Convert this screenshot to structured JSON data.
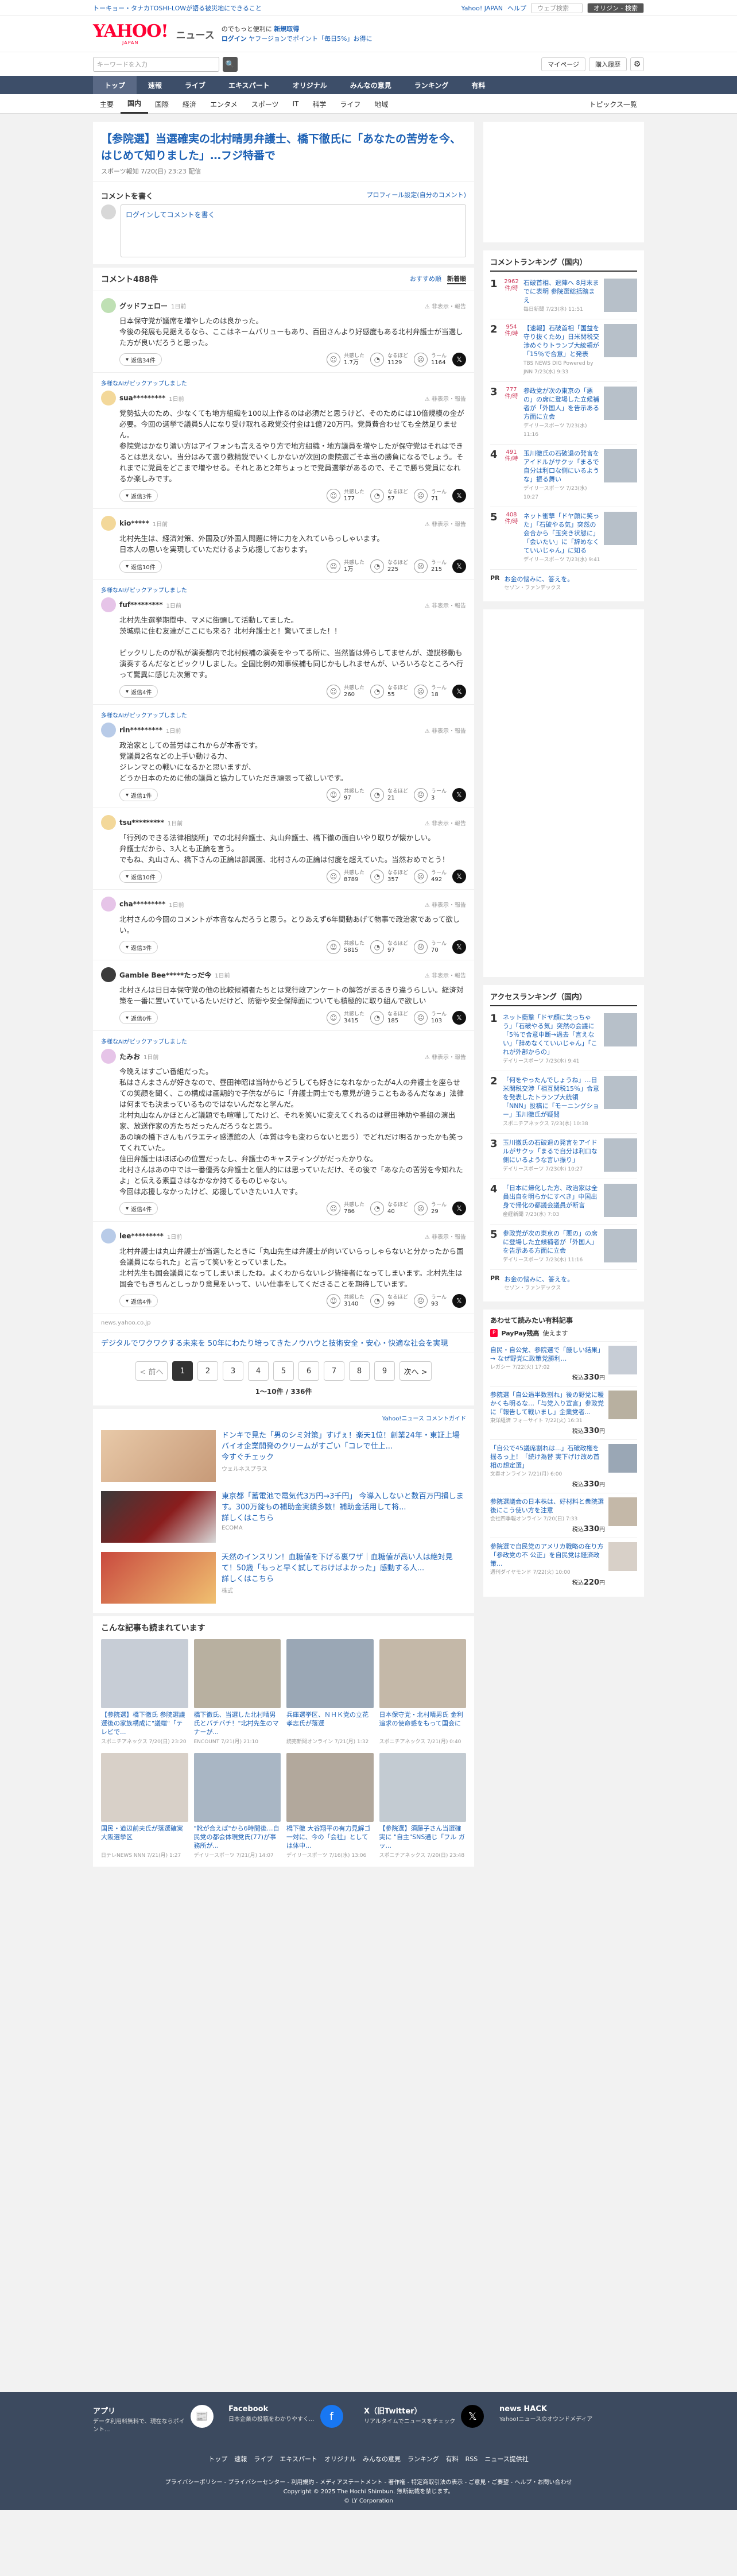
{
  "topstrip": {
    "promo": "トーキョー・タナカTOSHI-LOWが語る被災地にできること",
    "right": [
      "Yahoo! JAPAN",
      "ヘルプ"
    ],
    "search_placeholder": "ウェブ検索",
    "search_btn": "オリジン - 検索"
  },
  "header": {
    "logo": "YAHOO!",
    "logo_sub": "JAPAN",
    "news": "ニュース",
    "line1": "のでもっと便利に",
    "line1_link": "新規取得",
    "line2_login": "ログイン",
    "line2_link": "ヤフージョンでポイント「毎日5%」お得に"
  },
  "search": {
    "placeholder": "キーワードを入力",
    "btn": "🔍",
    "mypage": "マイページ",
    "settings": "購入履歴"
  },
  "nav1": [
    "トップ",
    "速報",
    "ライブ",
    "エキスパート",
    "オリジナル",
    "みんなの意見",
    "ランキング",
    "有料"
  ],
  "nav2": [
    "主要",
    "国内",
    "国際",
    "経済",
    "エンタメ",
    "スポーツ",
    "IT",
    "科学",
    "ライフ",
    "地域"
  ],
  "nav2_right": "トピックス一覧",
  "article": {
    "title": "【参院選】当選確実の北村晴男弁護士、橋下徹氏に「あなたの苦労を今、はじめて知りました」…フジ特番で",
    "source": "スポーツ報知 7/20(日) 23:23 配信"
  },
  "comment_write": {
    "title": "コメントを書く",
    "profile_link": "プロフィール設定(自分のコメント)",
    "placeholder": "ログインしてコメントを書く"
  },
  "comment_head": {
    "title": "コメント488件",
    "sort1": "おすすめ順",
    "sort2": "新着順"
  },
  "comments": [
    {
      "pick": "",
      "name": "グッドフェロー",
      "time": "1日前",
      "body": "日本保守党が議席を増やしたのは良かった。\n今後の発展も見据えるなら、ここはネームバリューもあり、百田さんより好感度もある北村弁護士が当選した方が良いだろうと思った。",
      "replies": "返信34件",
      "v1": "1.7万",
      "v2": "1129",
      "v3": "1164"
    },
    {
      "pick": "多様なAIがピックアップしました",
      "name": "sua*********",
      "time": "1日前",
      "body": "党勢拡大のため、少なくても地方組織を100以上作るのは必須だと思うけど、そのためには10倍規模の金が必要。今回の選挙で議員5人になり受け取れる政党交付金は1億720万円。党員費合わせても全然足りません。\n参院党はかなり潰い方はアイフォンも言えるやり方で地方組織・地方議員を増やしたが保守党はそれはできるとは思えない。当分はみて選り数精鋭でいくしかないが次回の衆院選ごそ本当の勝負になるでしょう。それまでに党員をどこまで増やせる。それとあと2年ちょっとで党員選挙があるので、そこで勝ち党員になれるか楽しみです。",
      "replies": "返信3件",
      "v1": "177",
      "v2": "57",
      "v3": "71"
    },
    {
      "pick": "",
      "name": "kio*****",
      "time": "1日前",
      "body": "北村先生は、経済対策、外国及び外国人問題に特に力を入れていらっしゃいます。\n日本人の思いを実現していただけるよう応援しております。",
      "replies": "返信10件",
      "v1": "1万",
      "v2": "225",
      "v3": "215"
    },
    {
      "pick": "多様なAIがピックアップしました",
      "name": "fuf*********",
      "time": "1日前",
      "body": "北村先生選挙期間中、マメに街頭して活動してました。\n茨城県に住む友達がここにも来る？北村弁護士と！驚いてました！！\n\nピックリしたのが私が演奏都内で北村候補の演奏をやってる所に、当然皆は帰らしてませんが、遊説移動も演奏するんだなとビックリしました。全国比例の知事候補も同じかもしれませんが、いろいろなところへ行って驚異に感じた次第です。",
      "replies": "返信4件",
      "v1": "260",
      "v2": "55",
      "v3": "18"
    },
    {
      "pick": "多様なAIがピックアップしました",
      "name": "rin*********",
      "time": "1日前",
      "body": "政治家としての苦労はこれからが本番です。\n党議員2名などの上手い動ける力、\nジレンマとの戦いになるかと思いますが、\nどうか日本のために他の議員と協力していただき頑張って欲しいです。",
      "replies": "返信1件",
      "v1": "97",
      "v2": "21",
      "v3": "3"
    },
    {
      "pick": "",
      "name": "tsu*********",
      "time": "1日前",
      "body": "「行列のできる法律相談所」での北村弁護士、丸山弁護士、橋下徹の面白いやり取りが懐かしい。\n弁護士だから、3人とも正論を言う。\nでもね、丸山さん、橋下さんの正論は部属面、北村さんの正論は付度を超えていた。当然おめでとう！",
      "replies": "返信10件",
      "v1": "8789",
      "v2": "357",
      "v3": "492"
    },
    {
      "pick": "",
      "name": "cha*********",
      "time": "1日前",
      "body": "北村さんの今回のコメントが本音なんだろうと思う。とりあえず6年間動あげて物事で政治家であって欲しい。",
      "replies": "返信3件",
      "v1": "5815",
      "v2": "97",
      "v3": "70"
    },
    {
      "pick": "",
      "name": "Gamble Bee*****たっだ今",
      "time": "1日前",
      "body": "北村さんは日日本保守党の他の比較候補者たちとは党行政アンケートの解答がまるきり違うらしい。経済対策を一番に置いていているたいだけど、防衛や安全保障面についても積極的に取り組んで欲しい",
      "replies": "返信0件",
      "v1": "3415",
      "v2": "185",
      "v3": "103"
    },
    {
      "pick": "多様なAIがピックアップしました",
      "name": "たみお",
      "time": "1日前",
      "body": "今晩えほすごい番組だった。\n私はさんまさんが好きなので、昼田神昭は当時からどうしても好きになれなかったが4人の弁護士を座らせての笑顔を聞く、この構成は画期的で子供ながらに「弁護士同士でも意見が違うこともあるんだなぁ」法律は何までも決まっているものではないんだなと学んだ。\n北村丸山なんかほとんど議題でも喧嘩してたけど、それを笑いに変えてくれるのは昼田神助や番組の演出家、放送作家の方たちだったんだろうなと思う。\nあの頃の橋下さんもバラエティ感漂館の人（本質は今も変わらないと思う）でどれだけ明るかったかも笑ってくれていた。\n住田弁護士はほぼ心の位置だったし、弁護士のキャスティングがだったかりな。\n北村さんはあの中では一番優秀な弁護士と個人的には思っていただけ、その後で「あなたの苦労を今知れたよ」と伝える素直さはなかなか持てるものじゃない。\n今回は応援しなかったけど、応援していきたい1人です。",
      "replies": "返信4件",
      "v1": "786",
      "v2": "40",
      "v3": "29"
    },
    {
      "pick": "",
      "name": "lee*********",
      "time": "1日前",
      "body": "北村弁護士は丸山弁護士が当選したときに「丸山先生は弁護士が向いていらっしゃらないと分かったから国会議員になられた」と言って笑いをとっていました。\n北村先生も国会議員になってしまいましたね。よくわからないレジ皆接者になってしまいます。北村先生は国会でもきちんとしっかり意見をいって、いい仕事をしてくださることを期待しています。",
      "replies": "返信4件",
      "v1": "3140",
      "v2": "99",
      "v3": "93"
    }
  ],
  "yahoo_note": "news.yahoo.co.jp",
  "promo_comment": {
    "text": "デジタルでワクワクする未来を 50年にわたり培ってきたノウハウと技術安全・安心・快適な社会を実現",
    "sponsor": ""
  },
  "pager": {
    "prev": "< 前へ",
    "pages": [
      "1",
      "2",
      "3",
      "4",
      "5",
      "6",
      "7",
      "8",
      "9"
    ],
    "next": "次へ >",
    "count": "1〜10件 / 336件"
  },
  "ads": {
    "head": "Yahoo!ニュース コメントガイド",
    "items": [
      {
        "text": "ドンキで見た「男のシミ対策」すげぇ！楽天1位！創業24年・東証上場バイオ企業開発のクリームがすごい「コレで仕上...",
        "more": "今すぐチェック",
        "sponsor": "ウェルネスプラス"
      },
      {
        "text": "東京都「蓄電池で電気代3万円→3千円」 今導入しないと数百万円損します。300万錠もの補助金実績多数！補助金活用して将...",
        "more": "詳しくはこちら",
        "sponsor": "ECOMA"
      },
      {
        "text": "天然のインスリン！血糖値を下げる裏ワザ｜血糖値が高い人は絶対見て！50歳「もっと早く試しておけばよかった」感動する人...",
        "more": "詳しくはこちら",
        "sponsor": "株式"
      }
    ]
  },
  "read_more": {
    "title": "こんな記事も読まれています",
    "items": [
      {
        "t": "【参院選】橋下徹氏 参院選議選後の家族構成に\"議端\"「テレビで...",
        "s": "スポニチアネックス 7/20(日) 23:20"
      },
      {
        "t": "橋下徹氏、当選した北村晴男氏とバチバチ！\"北村先生のマナーが...",
        "s": "ENCOUNT 7/21(月) 21:10"
      },
      {
        "t": "兵庫選挙区、ＮＨＫ党の立花孝志氏が落選",
        "s": "読売新聞オンライン 7/21(月) 1:32"
      },
      {
        "t": "日本保守党・北村晴男氏 金利追求の使命感をもって国会に",
        "s": "スポニチアネックス 7/21(月) 0:40"
      },
      {
        "t": "国民・道辺前夫氏が落選確実 大阪選挙区",
        "s": "日テレNEWS NNN 7/21(月) 1:27"
      },
      {
        "t": "\"靴が合えば\"から6時間後…自民党の都会体現党氏(77)が事務所が...",
        "s": "デイリースポーツ 7/21(月) 14:07"
      },
      {
        "t": "橋下徹 大谷翔平の有力見解ゴ一対に、今の「会社」としては体中...",
        "s": "デイリースポーツ 7/16(水) 13:06"
      },
      {
        "t": "【参院選】須藤子さん当選確実に \"自主\"SNS通じ「フル ガッ...",
        "s": "スポニチアネックス 7/20(日) 23:48"
      }
    ]
  },
  "ranking": {
    "title": "コメントランキング（国内）",
    "items": [
      {
        "n": "1",
        "c": "2962",
        "cl": "件/時",
        "t": "石破首相、退陣へ 8月末までに表明 参院選総括踏まえ",
        "s": "毎日新聞 7/23(水) 11:51"
      },
      {
        "n": "2",
        "c": "954",
        "cl": "件/時",
        "t": "【速報】石破首相「国益を守り抜くため」日米関税交渉めぐりトランプ大統領が「15％で合意」と発表",
        "s": "TBS NEWS DIG Powered by JNN 7/23(水) 9:33"
      },
      {
        "n": "3",
        "c": "777",
        "cl": "件/時",
        "t": "参政党が次の東京の「悪の」の席に登場した立候補者が「外国人」を告示ある方面に立会",
        "s": "デイリースポーツ 7/23(水) 11:16"
      },
      {
        "n": "4",
        "c": "491",
        "cl": "件/時",
        "t": "玉川徹氏の石破退の発言をアイドルがサクッ「まるで自分は利口な側にいるような」振る舞い",
        "s": "デイリースポーツ 7/23(水) 10:27"
      },
      {
        "n": "5",
        "c": "408",
        "cl": "件/時",
        "t": "ネット衝撃「ドヤ顔に笑った」「石破やる気」突然の会合から「玉突き状態に」「会いたい」に「辞めなくていいじゃん」に知る",
        "s": "デイリースポーツ 7/23(水) 9:41"
      }
    ],
    "pr": {
      "label": "PR",
      "t": "お金の悩みに、答えを。",
      "s": "セゾン・ファンデックス"
    }
  },
  "access": {
    "title": "アクセスランキング（国内）",
    "items": [
      {
        "n": "1",
        "t": "ネット衝撃「ドヤ顔に笑っちゃう」「石破やる気」突然の会議に「5％で合意中断→過去「言えない」「辞めなくていいじゃん」「これが外部からの」",
        "s": "デイリースポーツ 7/23(水) 9:41"
      },
      {
        "n": "2",
        "t": "「何をやったんでしょうね」…日米関税交渉「相互関税15％」合意を発表したトランプ大統領「NNN」投稿に「モーニングショー」玉川徹氏が疑問",
        "s": "スポニチアネックス 7/23(水) 10:38"
      },
      {
        "n": "3",
        "t": "玉川徹氏の石破退の発言をアイドルがサクッ「まるで自分は利口な側にいるような言い振り」",
        "s": "デイリースポーツ 7/23(水) 10:27"
      },
      {
        "n": "4",
        "t": "「日本に帰化した方、政治家は全員出自を明らかにすべき」中国出身で帰化の都議会議員が断言",
        "s": "産経新聞 7/23(水) 7:03"
      },
      {
        "n": "5",
        "t": "参政党が次の東京の「悪の」の席に登場した立候補者が「外国人」を告示ある方面に立会",
        "s": "デイリースポーツ 7/23(水) 11:16"
      }
    ],
    "pr": {
      "label": "PR",
      "t": "お金の悩みに、答えを。",
      "s": "セゾン・ファンデックス"
    }
  },
  "shop": {
    "title": "あわせて読みたい有料記事",
    "paypay": "PayPay残高",
    "paypay_tag": "使えます",
    "items": [
      {
        "t": "自民・自公党、参院選で「厳しい結果」→ なぜ野党に政策党勝利...",
        "s": "レガシー 7/22(火) 17:02",
        "p": "330"
      },
      {
        "t": "参院選「自公過半数割れ」後の野党に暖かくも明るな…「与党入り宣言」参政党に「報告して戦いまし」企業党者...",
        "s": "東洋経済 フォーサイト 7/22(火) 16:31",
        "p": "330"
      },
      {
        "t": "「自公で45議席割れは...」石破政権を揺るっ上！「続け為替 実下げけ改め首相の想定選」",
        "s": "文春オンライン 7/21(月) 6:00",
        "p": "330"
      },
      {
        "t": "参院選議会の日本株は、好材料と衆院選後にこう使い方を注意",
        "s": "会社四季報オンライン 7/20(日) 7:33",
        "p": "330"
      },
      {
        "t": "参院選で自民党のアメリカ戦略の在り方「参政党の不 公正」を自民党は経済政策...",
        "s": "週刊ダイヤモンド 7/22(火) 10:00",
        "p": "220"
      }
    ]
  },
  "footer": {
    "cols": [
      {
        "t": "アプリ",
        "d": "データ利用料無料で、現在ならポイント..."
      },
      {
        "t": "Facebook",
        "d": "日本企業の投稿をわかりやすく..."
      },
      {
        "t": "X（旧Twitter）",
        "d": "リアルタイムでニュースをチェック"
      },
      {
        "t": "news HACK",
        "d": "Yahoo!ニュースのオウンドメディア"
      }
    ],
    "links": [
      "トップ",
      "速報",
      "ライブ",
      "エキスパート",
      "オリジナル",
      "みんなの意見",
      "ランキング",
      "有料",
      "RSS",
      "ニュース提供社"
    ],
    "legal": "プライバシーポリシー - プライバシーセンター - 利用規約 - メディアステートメント - 著作権 - 特定商取引法の表示 - ご意見・ご要望 - ヘルプ・お問い合わせ",
    "copyright": "Copyright © 2025 The Hochi Shimbun. 無断転載を禁じます。",
    "corp": "© LY Corporation"
  }
}
